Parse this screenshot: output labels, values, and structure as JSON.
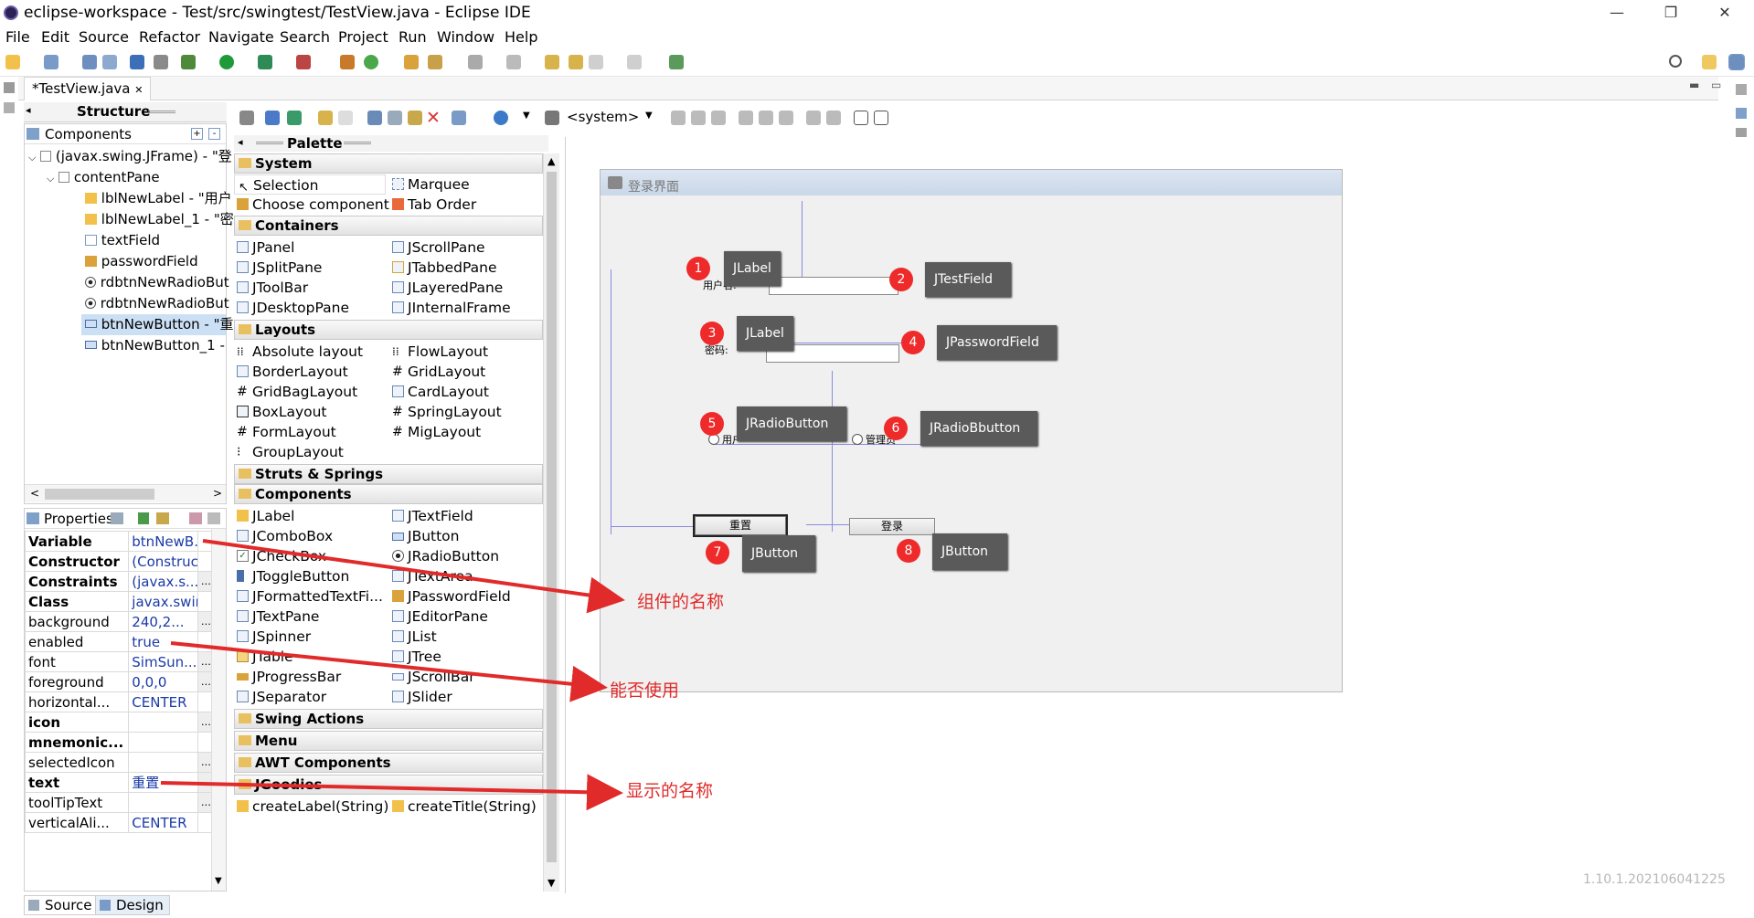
{
  "window": {
    "title": "eclipse-workspace - Test/src/swingtest/TestView.java - Eclipse IDE",
    "minimize": "—",
    "restore": "❐",
    "close": "✕"
  },
  "menubar": [
    "File",
    "Edit",
    "Source",
    "Refactor",
    "Navigate",
    "Search",
    "Project",
    "Run",
    "Window",
    "Help"
  ],
  "editor_tab": {
    "label": "*TestView.java",
    "close": "✕"
  },
  "structure": {
    "title": "Structure",
    "components_label": "Components",
    "tree": [
      "(javax.swing.JFrame) - \"登",
      "contentPane",
      "lblNewLabel - \"用户",
      "lblNewLabel_1 - \"密",
      "textField",
      "passwordField",
      "rdbtnNewRadioBut",
      "rdbtnNewRadioBut",
      "btnNewButton - \"重",
      "btnNewButton_1 -"
    ]
  },
  "properties": {
    "title": "Properties",
    "rows": [
      {
        "name": "Variable",
        "value": "btnNewB...",
        "bold": true
      },
      {
        "name": "Constructor",
        "value": "(Construc...",
        "bold": true
      },
      {
        "name": "Constraints",
        "value": "(javax.s...",
        "bold": true
      },
      {
        "name": "Class",
        "value": "javax.swin...",
        "bold": true
      },
      {
        "name": "background",
        "value": "240,2...",
        "bold": false
      },
      {
        "name": "enabled",
        "value": "true",
        "bold": false
      },
      {
        "name": "font",
        "value": "SimSun...",
        "bold": false
      },
      {
        "name": "foreground",
        "value": "0,0,0",
        "bold": false
      },
      {
        "name": "horizontal...",
        "value": "CENTER",
        "bold": false
      },
      {
        "name": "icon",
        "value": "",
        "bold": true
      },
      {
        "name": "mnemonic...",
        "value": "",
        "bold": true
      },
      {
        "name": "selectedIcon",
        "value": "",
        "bold": false
      },
      {
        "name": "text",
        "value": "重置",
        "bold": true
      },
      {
        "name": "toolTipText",
        "value": "",
        "bold": false
      },
      {
        "name": "verticalAli...",
        "value": "CENTER",
        "bold": false
      }
    ]
  },
  "palette": {
    "title": "Palette",
    "system_select": "<system>",
    "categories": {
      "system": "System",
      "containers": "Containers",
      "layouts": "Layouts",
      "struts": "Struts & Springs",
      "components": "Components",
      "swing_actions": "Swing Actions",
      "menu": "Menu",
      "awt": "AWT Components",
      "jgoodies": "JGoodies"
    },
    "system_items": [
      "Selection",
      "Marquee",
      "Choose component",
      "Tab Order"
    ],
    "container_items": [
      "JPanel",
      "JScrollPane",
      "JSplitPane",
      "JTabbedPane",
      "JToolBar",
      "JLayeredPane",
      "JDesktopPane",
      "JInternalFrame"
    ],
    "layout_items": [
      "Absolute layout",
      "FlowLayout",
      "BorderLayout",
      "GridLayout",
      "GridBagLayout",
      "CardLayout",
      "BoxLayout",
      "SpringLayout",
      "FormLayout",
      "MigLayout",
      "GroupLayout"
    ],
    "component_items": [
      "JLabel",
      "JTextField",
      "JComboBox",
      "JButton",
      "JCheckBox",
      "JRadioButton",
      "JToggleButton",
      "JTextArea",
      "JFormattedTextFi...",
      "JPasswordField",
      "JTextPane",
      "JEditorPane",
      "JSpinner",
      "JList",
      "JTable",
      "JTree",
      "JProgressBar",
      "JScrollBar",
      "JSeparator",
      "JSlider"
    ],
    "jgoodies_items": [
      "createLabel(String)",
      "createTitle(String)"
    ]
  },
  "design": {
    "frame_title": "登录界面",
    "label_user": "用户名:",
    "label_pwd": "密码:",
    "radio_user": "用户",
    "radio_admin": "管理员",
    "btn_reset": "重置",
    "btn_login": "登录"
  },
  "callouts": [
    {
      "num": "1",
      "text": "JLabel"
    },
    {
      "num": "2",
      "text": "JTestField"
    },
    {
      "num": "3",
      "text": "JLabel"
    },
    {
      "num": "4",
      "text": "JPasswordField"
    },
    {
      "num": "5",
      "text": "JRadioButton"
    },
    {
      "num": "6",
      "text": "JRadioBbutton"
    },
    {
      "num": "7",
      "text": "JButton"
    },
    {
      "num": "8",
      "text": "JButton"
    }
  ],
  "annotations": {
    "component_name": "组件的名称",
    "enabled": "能否使用",
    "display_name": "显示的名称"
  },
  "bottom_tabs": {
    "source": "Source",
    "design": "Design"
  },
  "version": "1.10.1.202106041225"
}
